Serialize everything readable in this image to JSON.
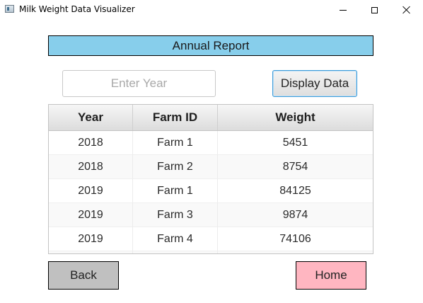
{
  "window": {
    "title": "Milk Weight Data Visualizer"
  },
  "banner": {
    "title": "Annual Report",
    "color": "#87ceeb"
  },
  "search": {
    "placeholder": "Enter Year",
    "value": "",
    "button_label": "Display Data"
  },
  "table": {
    "columns": [
      "Year",
      "Farm ID",
      "Weight"
    ],
    "rows": [
      [
        "2018",
        "Farm 1",
        "5451"
      ],
      [
        "2018",
        "Farm 2",
        "8754"
      ],
      [
        "2019",
        "Farm 1",
        "84125"
      ],
      [
        "2019",
        "Farm 3",
        "9874"
      ],
      [
        "2019",
        "Farm 4",
        "74106"
      ],
      [
        "",
        "",
        ""
      ]
    ]
  },
  "footer": {
    "back_label": "Back",
    "back_color": "#c0c0c0",
    "home_label": "Home",
    "home_color": "#ffb6c1"
  }
}
